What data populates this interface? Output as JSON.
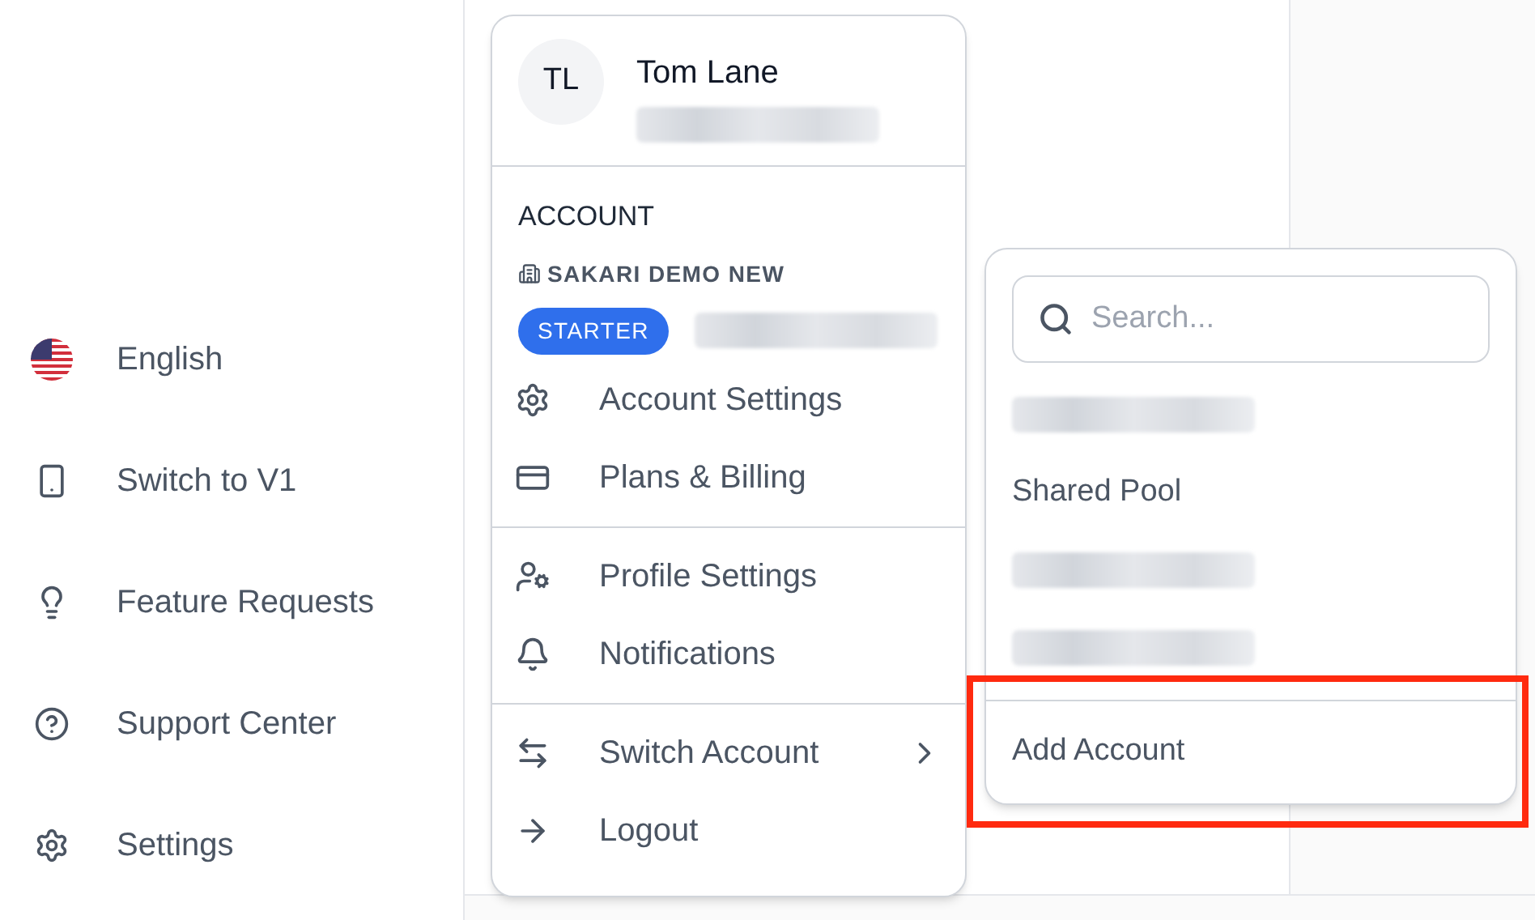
{
  "sidebar": {
    "items": [
      {
        "label": "English",
        "kind": "flag"
      },
      {
        "label": "Switch to V1",
        "kind": "device"
      },
      {
        "label": "Feature Requests",
        "kind": "bulb"
      },
      {
        "label": "Support Center",
        "kind": "help"
      },
      {
        "label": "Settings",
        "kind": "gear"
      }
    ]
  },
  "user_menu": {
    "avatar": "TL",
    "name": "Tom Lane",
    "section_label": "ACCOUNT",
    "account_name": "SAKARI DEMO NEW",
    "plan_badge": "STARTER",
    "groups": [
      [
        {
          "label": "Account Settings",
          "kind": "gear",
          "submenu": false
        },
        {
          "label": "Plans & Billing",
          "kind": "card",
          "submenu": false
        }
      ],
      [
        {
          "label": "Profile Settings",
          "kind": "user-gear",
          "submenu": false
        },
        {
          "label": "Notifications",
          "kind": "bell",
          "submenu": false
        }
      ],
      [
        {
          "label": "Switch Account",
          "kind": "swap",
          "submenu": true
        },
        {
          "label": "Logout",
          "kind": "arrow",
          "submenu": false
        }
      ]
    ]
  },
  "account_switcher": {
    "search": {
      "placeholder": "Search..."
    },
    "accounts": [
      {
        "kind": "redacted"
      },
      {
        "kind": "text",
        "label": "Shared Pool"
      },
      {
        "kind": "redacted"
      },
      {
        "kind": "redacted"
      }
    ],
    "add_account": {
      "label": "Add Account",
      "highlighted": true
    }
  }
}
